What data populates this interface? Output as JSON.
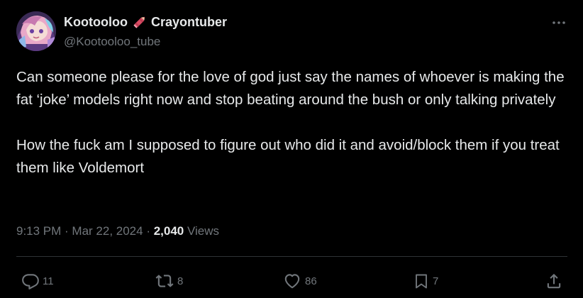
{
  "author": {
    "name_part1": "Kootooloo",
    "name_part2": "Crayontuber",
    "handle": "@Kootooloo_tube",
    "pencil_icon": "crayon-emoji-icon",
    "avatar_icon": "avatar-anime-character"
  },
  "tweet": {
    "paragraph1": "Can someone please for the love of god just say the names of whoever is making the fat ‘joke’ models right now and stop beating around the bush or only talking privately",
    "paragraph2": "How the fuck am I supposed to figure out who did it and avoid/block them if you treat them like Voldemort"
  },
  "meta": {
    "time": "9:13 PM",
    "separator": " · ",
    "date": "Mar 22, 2024",
    "separator2": " · ",
    "views_count": "2,040",
    "views_label": " Views"
  },
  "actions": {
    "replies": "11",
    "reposts": "8",
    "likes": "86",
    "bookmarks": "7"
  },
  "colors": {
    "background": "#000000",
    "text": "#e7e9ea",
    "muted": "#71767b",
    "divider": "#2f3336"
  }
}
